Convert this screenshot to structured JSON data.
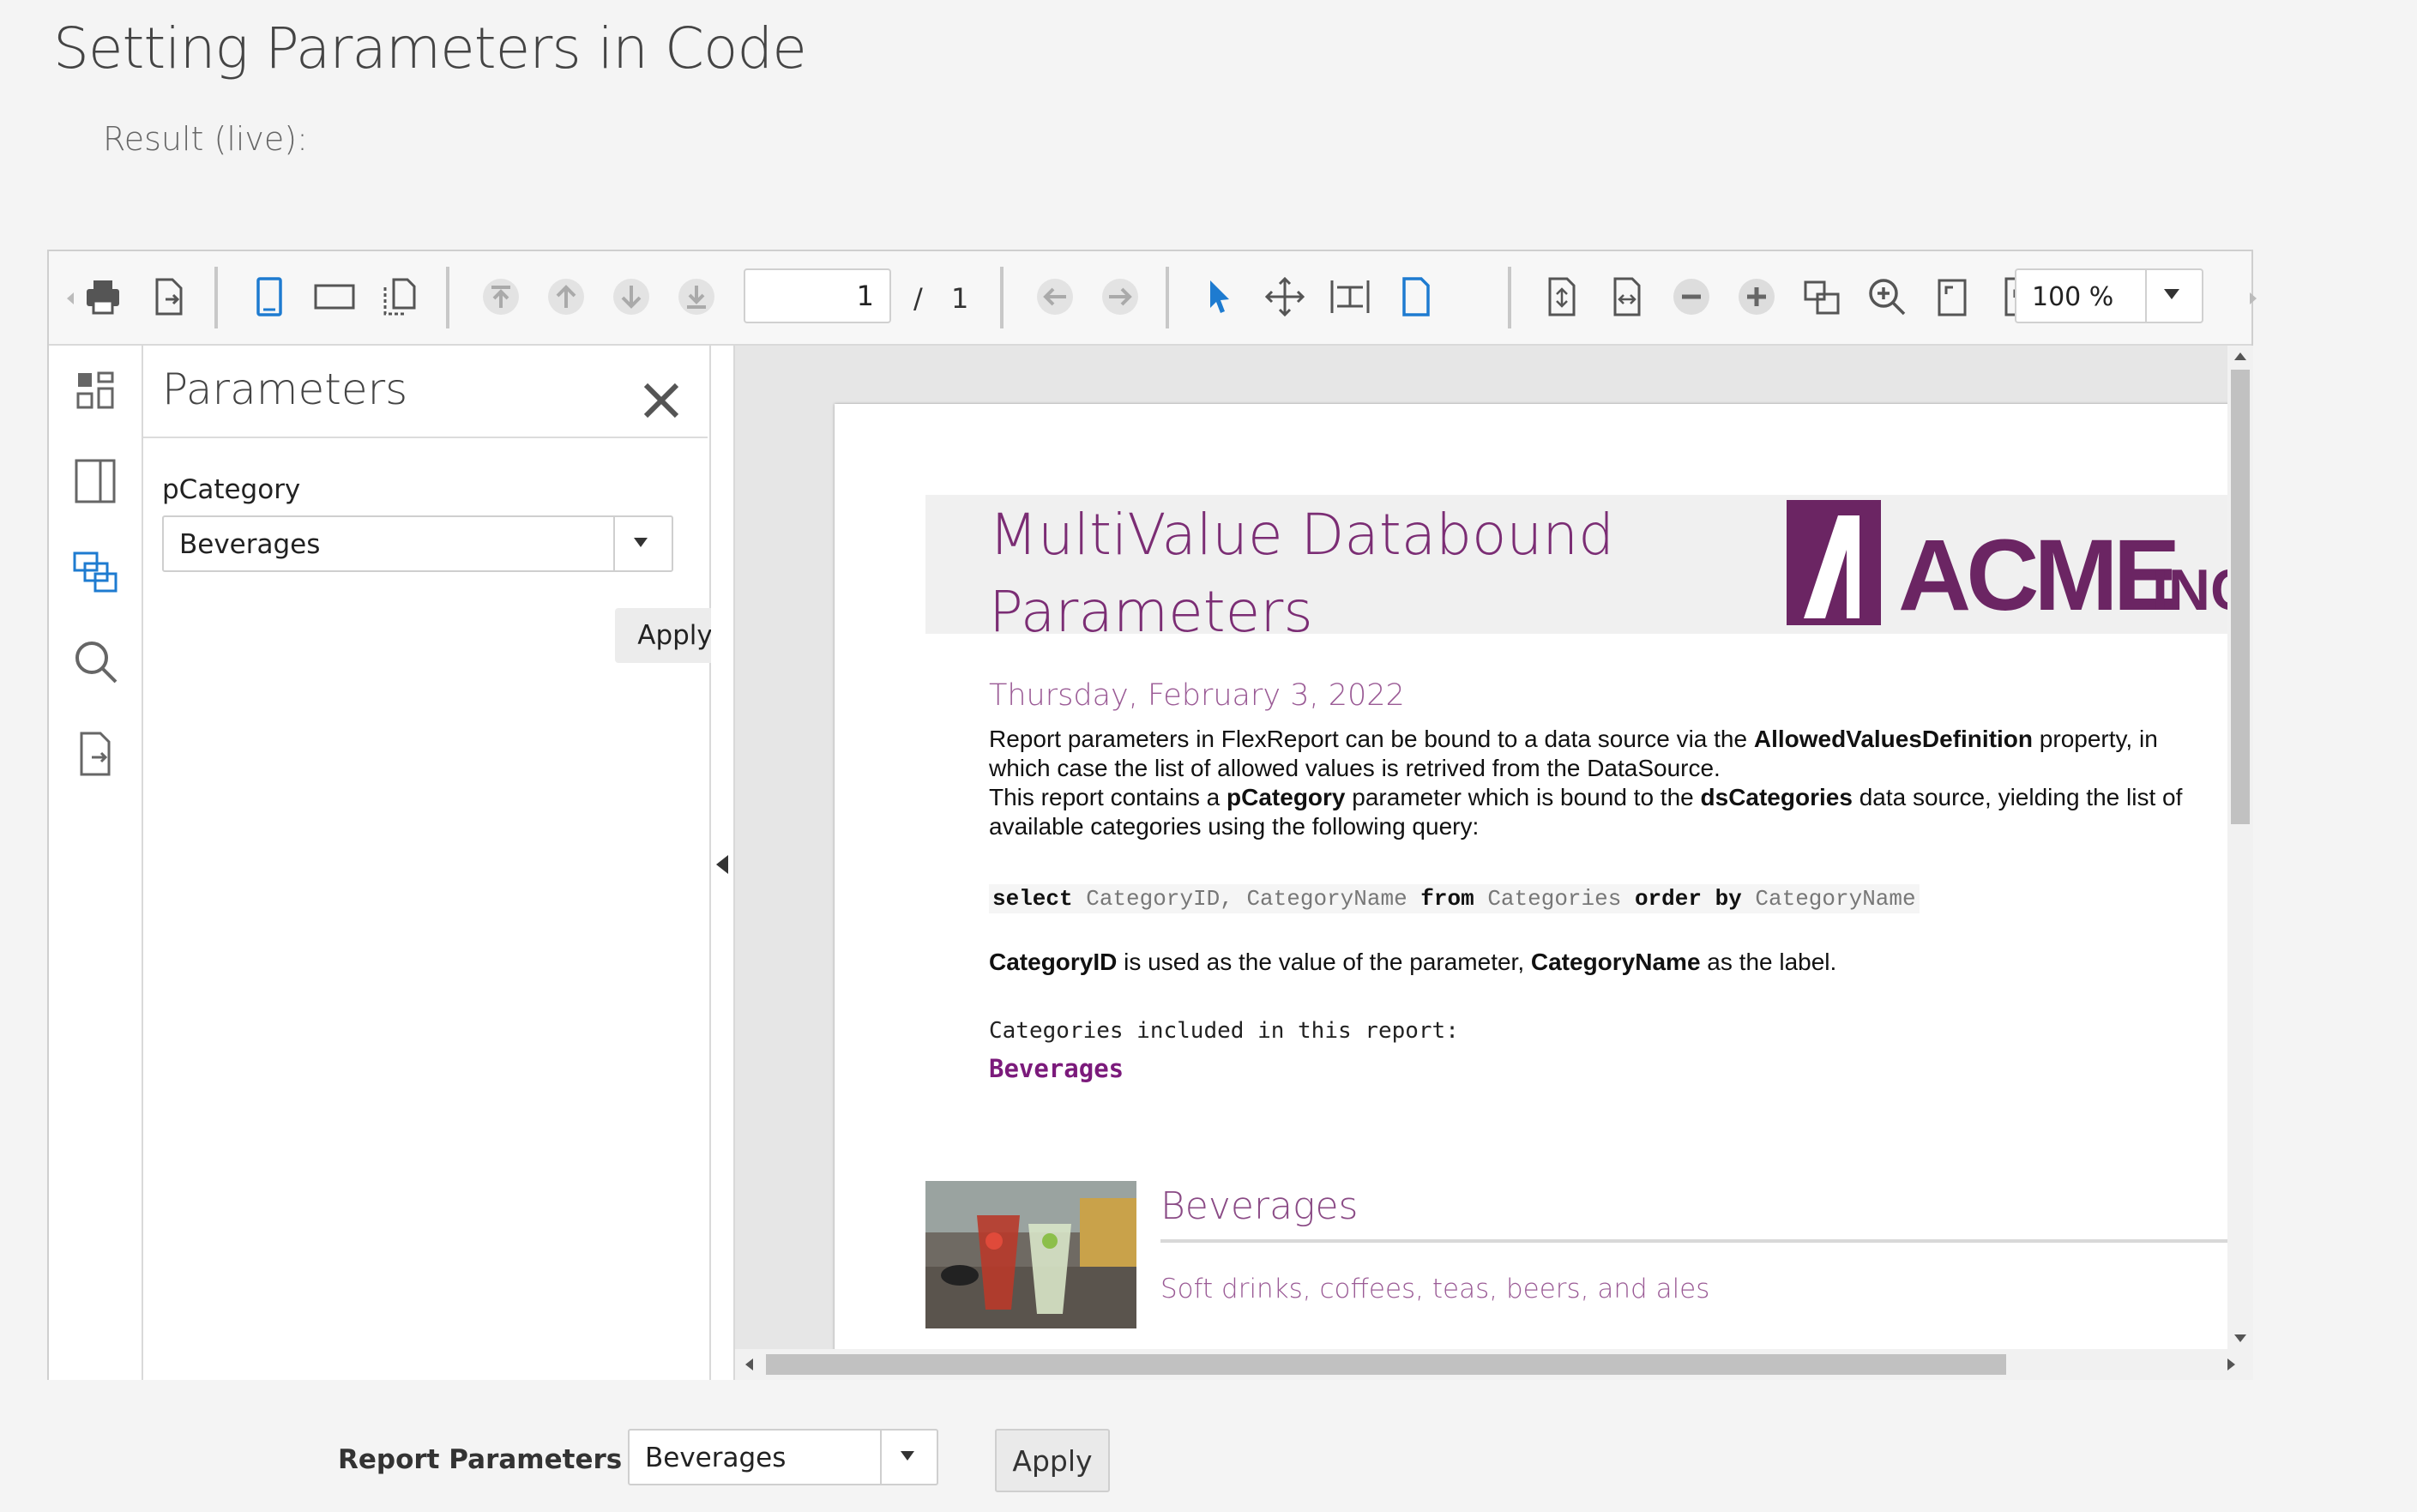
{
  "page": {
    "title": "Setting Parameters in Code",
    "result_label": "Result (live):"
  },
  "toolbar": {
    "icons": [
      "print-icon",
      "export-icon",
      "single-page-icon",
      "continuous-page-icon",
      "thumbnails-icon",
      "first-page-icon",
      "previous-page-icon",
      "next-page-icon",
      "last-page-icon",
      "back-icon",
      "forward-icon",
      "select-tool-icon",
      "move-tool-icon",
      "rubberband-tool-icon",
      "magnifier-page-icon",
      "fit-whole-page-icon",
      "fit-page-width-icon",
      "zoom-out-icon",
      "zoom-in-icon",
      "actual-size-icon",
      "zoom-tool-icon",
      "full-screen-icon",
      "rotate-page-icon"
    ],
    "page_number": "1",
    "page_separator": "/",
    "page_count": "1",
    "zoom": "100 %"
  },
  "sidebar": {
    "icons": [
      "thumbnails-panel-icon",
      "outline-panel-icon",
      "parameters-panel-icon",
      "search-panel-icon",
      "export-panel-icon"
    ]
  },
  "parameters_panel": {
    "title": "Parameters",
    "param_label": "pCategory",
    "param_value": "Beverages",
    "apply_label": "Apply"
  },
  "report": {
    "title_line1": "MultiValue Databound",
    "title_line2": "Parameters",
    "logo_text": "ACME",
    "logo_suffix": "INC.",
    "date": "Thursday, February 3, 2022",
    "p1_a": "Report parameters in FlexReport can be bound to a data source via the ",
    "p1_b": "AllowedValuesDefinition",
    "p1_c": " property, in which case the list of allowed values is retrived from the DataSource.",
    "p2_a": "This report contains a ",
    "p2_b": "pCategory",
    "p2_c": " parameter which is bound to the ",
    "p2_d": "dsCategories",
    "p2_e": " data source, yielding the list of available categories using the following query:",
    "code_select": "select",
    "code_cols": " CategoryID, CategoryName ",
    "code_from": "from",
    "code_table": " Categories ",
    "code_order": "order by",
    "code_col": " CategoryName",
    "p3_a": "CategoryID",
    "p3_b": " is used as the value of the parameter, ",
    "p3_c": "CategoryName",
    "p3_d": " as the label.",
    "included_label": "Categories included in this report:",
    "included_value": "Beverages",
    "category_name": "Beverages",
    "category_description": "Soft drinks, coffees, teas, beers, and ales"
  },
  "form": {
    "label": "Report Parameters",
    "select_value": "Beverages",
    "apply_label": "Apply"
  },
  "colors": {
    "accent": "#7b2d74",
    "toolbar_blue": "#1e7bd0"
  }
}
